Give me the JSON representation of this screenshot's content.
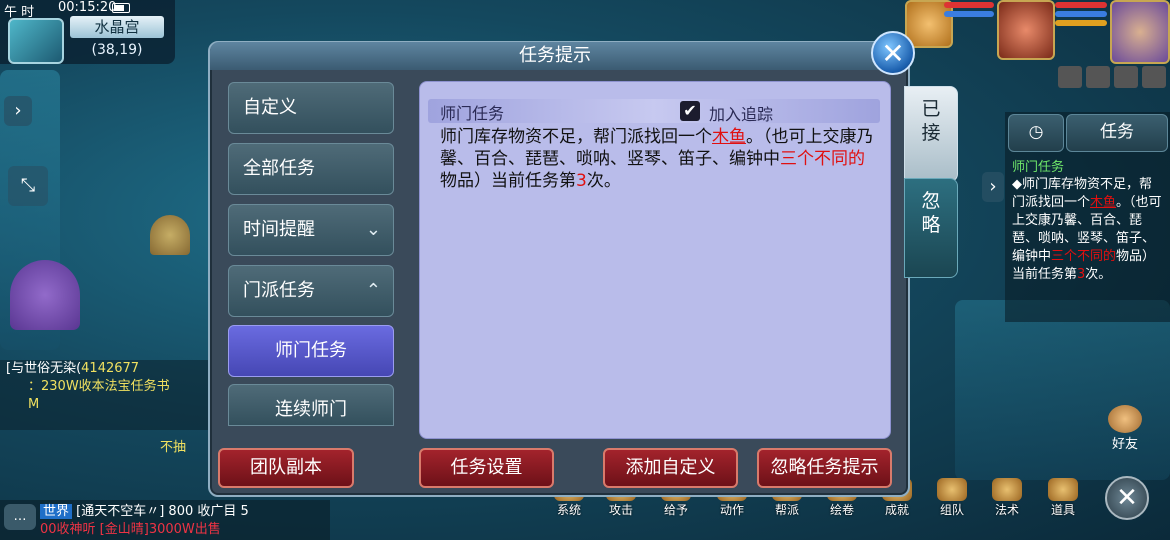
{
  "status": {
    "clock_label": "午 时",
    "time": "00:15:20"
  },
  "location": {
    "map_name": "水晶宫",
    "coords": "(38,19)"
  },
  "dialog": {
    "title": "任务提示",
    "side_tabs": {
      "accepted": "已接",
      "ignored": "忽略"
    },
    "categories": [
      {
        "label": "自定义"
      },
      {
        "label": "全部任务"
      },
      {
        "label": "时间提醒",
        "chevron": "chevron-down-icon"
      },
      {
        "label": "门派任务",
        "chevron": "chevron-up-icon"
      }
    ],
    "sub_items": [
      {
        "label": "师门任务",
        "active": true
      },
      {
        "label": "连续师门",
        "active": false
      }
    ],
    "task": {
      "name": "师门任务",
      "track_label": "加入追踪",
      "track_checked": true,
      "desc_part1": "师门库存物资不足，帮门派找回一个",
      "desc_item": "木鱼",
      "desc_part2": "。（也可上交康乃馨、百合、琵琶、唢呐、竖琴、笛子、编钟中",
      "desc_highlight": "三个不同的",
      "desc_part3": "物品）当前任务第",
      "desc_count": "3",
      "desc_part4": "次。"
    },
    "buttons": {
      "team_dungeon": "团队副本",
      "task_settings": "任务设置",
      "add_custom": "添加自定义",
      "ignore_hints": "忽略任务提示"
    }
  },
  "tracker": {
    "timer_icon": "clock-icon",
    "tab_label": "任务",
    "title": "师门任务",
    "line_a": "◆师门库存物资不足，帮门派找回一个",
    "item": "木鱼",
    "line_b": "。（也可上交康乃馨、百合、琵琶、唢呐、竖琴、笛子、编钟中",
    "highlight": "三个不同的",
    "line_c": "物品）当前任务第",
    "count": "3",
    "line_d": "次。"
  },
  "chat": {
    "line1_name": "[与世俗无染(",
    "line1_id": "4142677",
    "line2": "：230W收本法宝任务书",
    "line3": "M",
    "line4": "不抽",
    "world_tag": "世界",
    "world_msg": "[通天不空车〃] 800 收广目 5",
    "world_msg2": "00收神听   [金山晴]3000W出售"
  },
  "toolbar": {
    "items": [
      "系统",
      "攻击",
      "给予",
      "动作",
      "帮派",
      "绘卷",
      "成就",
      "组队",
      "法术",
      "道具"
    ],
    "friends": "好友"
  },
  "colors": {
    "accent_red": "#e01010",
    "tracker_green": "#6fe86a",
    "active_purple": "#5658cc"
  }
}
